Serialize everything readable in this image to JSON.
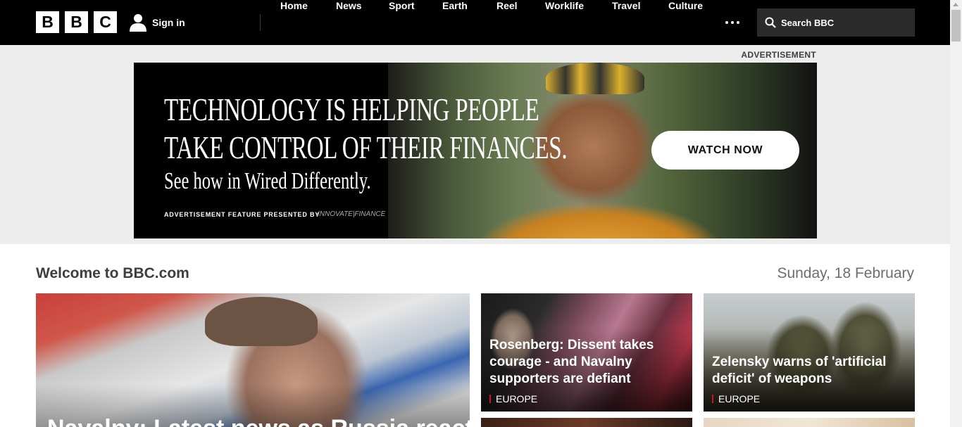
{
  "header": {
    "logo_letters": [
      "B",
      "B",
      "C"
    ],
    "sign_in": "Sign in",
    "nav": [
      "Home",
      "News",
      "Sport",
      "Earth",
      "Reel",
      "Worklife",
      "Travel",
      "Culture"
    ],
    "more_icon": "more-dots-icon",
    "search_placeholder": "Search BBC"
  },
  "ad": {
    "label": "ADVERTISEMENT",
    "headline_line1": "TECHNOLOGY IS HELPING PEOPLE",
    "headline_line2": "TAKE CONTROL OF THEIR FINANCES.",
    "subline": "See how in Wired Differently.",
    "feature_text": "ADVERTISEMENT FEATURE PRESENTED BY",
    "sponsor": "INNOVATE|FINANCE",
    "cta": "WATCH NOW"
  },
  "main": {
    "welcome": "Welcome to BBC.com",
    "date": "Sunday, 18 February",
    "hero_title": "Navalny: Latest news as Russia reacts",
    "cards": [
      {
        "title": "Rosenberg: Dissent takes courage - and Navalny supporters are defiant",
        "tag": "EUROPE"
      },
      {
        "title": "Zelensky warns of 'artificial deficit' of weapons",
        "tag": "EUROPE"
      }
    ]
  },
  "colors": {
    "topbar": "#000000",
    "ad_area": "#ededed",
    "tag_accent": "#d0121b"
  }
}
